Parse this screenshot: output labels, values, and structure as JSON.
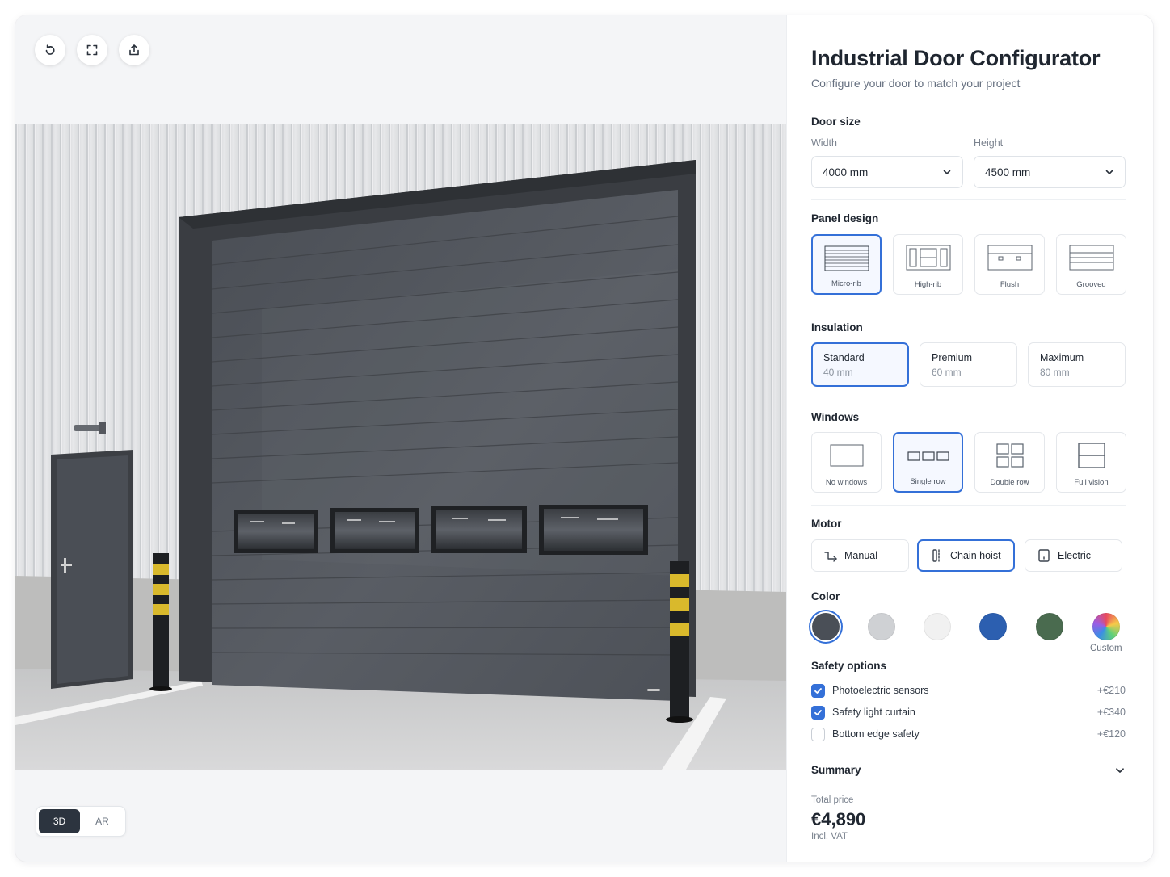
{
  "toolbar": {
    "icons": [
      "reset-icon",
      "fullscreen-icon",
      "share-icon"
    ]
  },
  "view_modes": {
    "items": [
      "3D",
      "AR"
    ],
    "active": "3D"
  },
  "panel": {
    "title": "Industrial Door Configurator",
    "subtitle": "Configure your door to match your project",
    "door_size": {
      "label": "Door size",
      "width_label": "Width",
      "width_value": "4000 mm",
      "height_label": "Height",
      "height_value": "4500 mm"
    },
    "panel_design": {
      "label": "Panel design",
      "options": [
        "Micro-rib",
        "High-rib",
        "Flush",
        "Grooved"
      ],
      "selected": "Micro-rib"
    },
    "insulation": {
      "label": "Insulation",
      "options": [
        {
          "name": "Standard",
          "spec": "40 mm"
        },
        {
          "name": "Premium",
          "spec": "60 mm"
        },
        {
          "name": "Maximum",
          "spec": "80 mm"
        }
      ],
      "selected": "Standard"
    },
    "windows": {
      "label": "Windows",
      "options": [
        "No windows",
        "Single row",
        "Double row",
        "Full vision"
      ],
      "selected": "Single row"
    },
    "motor": {
      "label": "Motor",
      "options": [
        "Manual",
        "Chain hoist",
        "Electric"
      ],
      "selected": "Chain hoist"
    },
    "color": {
      "label": "Color",
      "swatches": [
        "#4a4f57",
        "#cfd1d4",
        "#f1f1f1",
        "#2c5fb0",
        "#4a6b4f"
      ],
      "selected": "#4a4f57",
      "custom_label": "Custom"
    },
    "safety": {
      "label": "Safety options",
      "items": [
        {
          "label": "Photoelectric sensors",
          "price": "+€210",
          "checked": true
        },
        {
          "label": "Safety light curtain",
          "price": "+€340",
          "checked": true
        },
        {
          "label": "Bottom edge safety",
          "price": "+€120",
          "checked": false
        }
      ]
    },
    "summary": {
      "label": "Summary",
      "total_label": "Total price",
      "total": "€4,890",
      "vat": "Incl. VAT"
    }
  }
}
